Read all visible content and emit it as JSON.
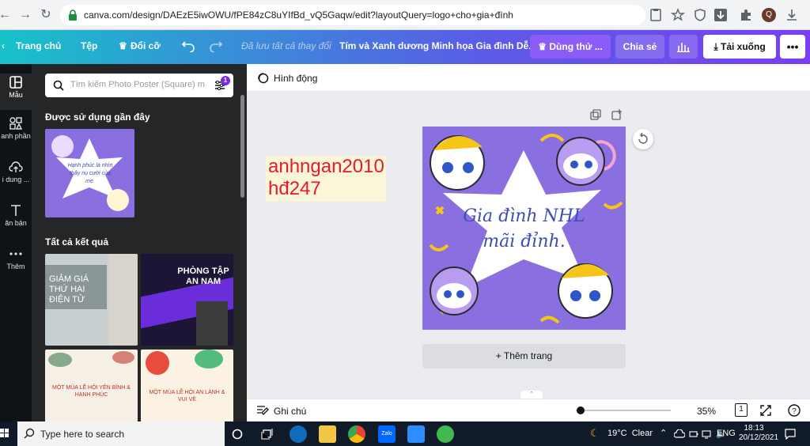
{
  "browser": {
    "url": "canva.com/design/DAEzE5iwOWU/fPE84zC8uYIfBd_vQ5Gaqw/edit?layoutQuery=logo+cho+gia+đình",
    "profile_initial": "Q"
  },
  "header": {
    "home": "Trang chủ",
    "file": "Tệp",
    "resize": "Đổi cỡ",
    "saved": "Đã lưu tất cả thay đổi",
    "title": "Tím và Xanh dương Minh họa Gia đình Dễ...",
    "try_pro": "Dùng thử ...",
    "share": "Chia sẻ",
    "download": "Tải xuống"
  },
  "rail": {
    "items": [
      {
        "label": "Mẫu"
      },
      {
        "label": "anh phần"
      },
      {
        "label": "i dung ..."
      },
      {
        "label": "ăn bản"
      },
      {
        "label": "Thêm"
      }
    ]
  },
  "panel": {
    "search_placeholder": "Tìm kiếm Photo Poster (Square) m...",
    "filter_badge": "1",
    "recent_heading": "Được sử dụng gần đây",
    "recent_thumb_text": "Hạnh phúc là nhìn thấy nụ cười của mẹ.",
    "results_heading": "Tất cả kết quả",
    "results": [
      {
        "text": "GIẢM GIÁ THỨ HAI ĐIỆN TỬ"
      },
      {
        "text": "PHÒNG TẬP AN NAM"
      },
      {
        "text": "MỘT MÙA LỄ HỘI YÊN BÌNH & HẠNH PHÚC"
      },
      {
        "text": "MỘT MÙA LỄ HỘI AN LÀNH & VUI VẺ"
      }
    ]
  },
  "editor": {
    "animate": "Hình động",
    "overlay_line1": "anhngan2010",
    "overlay_line2": "hđ247",
    "design_line1": "Gia đình NHL",
    "design_line2": "mãi đỉnh.",
    "add_page": "+ Thêm trang",
    "notes": "Ghi chú",
    "zoom": "35%",
    "zoom_fraction": 0.05,
    "page_number": "1"
  },
  "taskbar": {
    "search": "Type here to search",
    "weather": "19°C  Clear",
    "lang": "ENG",
    "time": "18:13",
    "date": "20/12/2021"
  },
  "colors": {
    "header_gradient_start": "#17c2c9",
    "header_gradient_end": "#7a3ff0",
    "design_bg": "#8a6fe0",
    "design_text": "#3f4db5",
    "overlay_text": "#e8192c",
    "download_bg": "#ffffff",
    "try_pro_bg": "#8b5cf6"
  }
}
